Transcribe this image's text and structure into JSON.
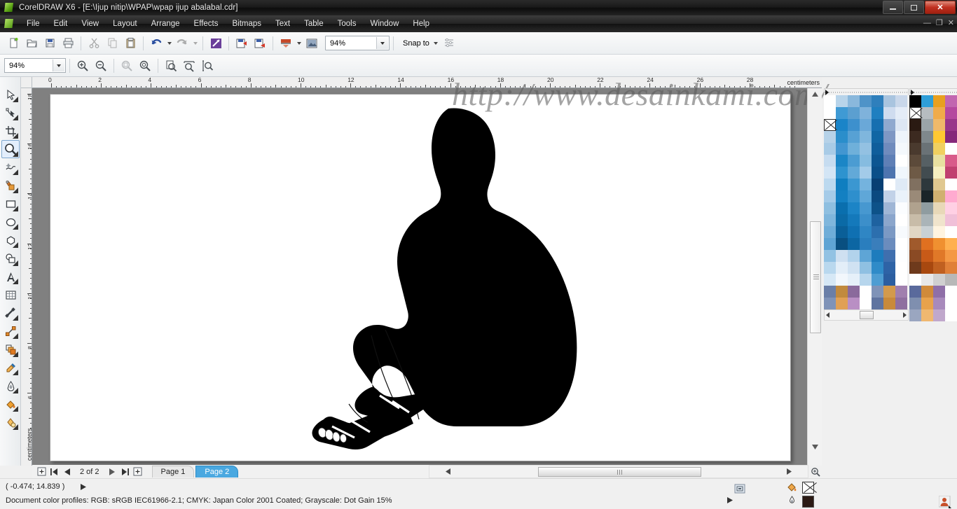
{
  "window": {
    "title": "CorelDRAW X6 - [E:\\Ijup nitip\\WPAP\\wpap ijup abalabal.cdr]",
    "app_name": "CorelDRAW X6",
    "minimize_label": "—",
    "restore_label": "❐",
    "close_label": "✕",
    "doc_minimize": "—",
    "doc_restore": "❐",
    "doc_close": "✕"
  },
  "menubar": {
    "items": [
      {
        "label": "File"
      },
      {
        "label": "Edit"
      },
      {
        "label": "View"
      },
      {
        "label": "Layout"
      },
      {
        "label": "Arrange"
      },
      {
        "label": "Effects"
      },
      {
        "label": "Bitmaps"
      },
      {
        "label": "Text"
      },
      {
        "label": "Table"
      },
      {
        "label": "Tools"
      },
      {
        "label": "Window"
      },
      {
        "label": "Help"
      }
    ]
  },
  "toolbar": {
    "zoom_value": "94%",
    "snap_label": "Snap to",
    "buttons": [
      {
        "name": "new-document",
        "tip": "New"
      },
      {
        "name": "open-document",
        "tip": "Open"
      },
      {
        "name": "save-document",
        "tip": "Save"
      },
      {
        "name": "print-document",
        "tip": "Print"
      },
      {
        "name": "cut",
        "tip": "Cut"
      },
      {
        "name": "copy",
        "tip": "Copy"
      },
      {
        "name": "paste",
        "tip": "Paste"
      },
      {
        "name": "undo",
        "tip": "Undo"
      },
      {
        "name": "redo",
        "tip": "Redo"
      },
      {
        "name": "import",
        "tip": "Import"
      },
      {
        "name": "export",
        "tip": "Export"
      },
      {
        "name": "publish-pdf",
        "tip": "Publish to PDF"
      },
      {
        "name": "application-launcher",
        "tip": "Application Launcher"
      },
      {
        "name": "corel-connect",
        "tip": "Corel CONNECT"
      },
      {
        "name": "options",
        "tip": "Options"
      }
    ]
  },
  "propertybar": {
    "zoom_value": "94%",
    "buttons": [
      {
        "name": "zoom-in"
      },
      {
        "name": "zoom-out"
      },
      {
        "name": "zoom-to-selected"
      },
      {
        "name": "zoom-to-all-objects"
      },
      {
        "name": "zoom-to-page"
      },
      {
        "name": "zoom-to-page-width"
      },
      {
        "name": "zoom-to-page-height"
      }
    ]
  },
  "toolbox": {
    "selected": "zoom-tool",
    "tools": [
      {
        "name": "pick-tool",
        "label": "Pick"
      },
      {
        "name": "shape-tool",
        "label": "Shape"
      },
      {
        "name": "crop-tool",
        "label": "Crop"
      },
      {
        "name": "zoom-tool",
        "label": "Zoom"
      },
      {
        "name": "freehand-tool",
        "label": "Freehand"
      },
      {
        "name": "smart-fill-tool",
        "label": "Smart Fill"
      },
      {
        "name": "rectangle-tool",
        "label": "Rectangle"
      },
      {
        "name": "ellipse-tool",
        "label": "Ellipse"
      },
      {
        "name": "polygon-tool",
        "label": "Polygon"
      },
      {
        "name": "basic-shapes-tool",
        "label": "Basic Shapes"
      },
      {
        "name": "text-tool",
        "label": "Text"
      },
      {
        "name": "table-tool",
        "label": "Table"
      },
      {
        "name": "dimension-tool",
        "label": "Parallel Dimension"
      },
      {
        "name": "connector-tool",
        "label": "Straight-Line Connector"
      },
      {
        "name": "blend-tool",
        "label": "Blend"
      },
      {
        "name": "color-eyedropper-tool",
        "label": "Color Eyedropper"
      },
      {
        "name": "outline-tool",
        "label": "Outline"
      },
      {
        "name": "fill-tool",
        "label": "Fill"
      },
      {
        "name": "interactive-fill-tool",
        "label": "Interactive Fill"
      }
    ]
  },
  "rulers": {
    "unit": "centimeters",
    "horizontal_labels": [
      "0",
      "2",
      "4",
      "6",
      "8",
      "10",
      "12",
      "14",
      "16",
      "18",
      "20",
      "22",
      "24",
      "26",
      "28"
    ],
    "vertical_labels": [
      "18",
      "16",
      "14",
      "12",
      "10",
      "8",
      "6"
    ]
  },
  "canvas": {
    "watermark": "http://www.desainkami.com/",
    "artwork_name": "sitting-person-silhouette"
  },
  "pagenav": {
    "count_label": "2 of 2",
    "tabs": [
      {
        "label": "Page 1",
        "active": false
      },
      {
        "label": "Page 2",
        "active": true
      }
    ],
    "add_page_left": "+",
    "first": "|◀",
    "prev": "◀",
    "next": "▶",
    "last": "▶|",
    "add_page_right": "+"
  },
  "statusbar": {
    "coordinates": "( -0.474; 14.839 )",
    "color_profiles": "Document color profiles: RGB: sRGB IEC61966-2.1; CMYK: Japan Color 2001 Coated; Grayscale: Dot Gain 15%",
    "fill_label": "Fill",
    "outline_label": "Outline",
    "fill_color": "none",
    "outline_color": "#2b1a14"
  },
  "palettes": {
    "custom": {
      "name": "custom-blue-palette",
      "columns": 7,
      "colors": [
        "#ffffff",
        "#b8d4ea",
        "#8ab8dc",
        "#4f93c8",
        "#2f7fbc",
        "#a9c4df",
        "#c9d7ea",
        "#ffffff",
        "#3f9ad4",
        "#5b9fd0",
        "#7fb2db",
        "#1f7fc0",
        "#cfdcef",
        "#e4ecf7",
        "#9cc3e2",
        "#1a84c8",
        "#3d90cd",
        "#6aa8d8",
        "#176fb0",
        "#8fa9cf",
        "#dde7f4",
        "#b6d2e8",
        "#2a8ecb",
        "#57a1d4",
        "#7fb6dd",
        "#1166a4",
        "#7e97c4",
        "#eef4fb",
        "#a8cbe6",
        "#4296d1",
        "#6fb0da",
        "#93c1e2",
        "#0f5e9c",
        "#6f8bbd",
        "#f4f8fc",
        "#c6dcf0",
        "#1b86c6",
        "#4b9cd2",
        "#86bce0",
        "#0c5692",
        "#5e7fb6",
        "#ffffff",
        "#d3e5f5",
        "#2d93cf",
        "#62a9d8",
        "#a3cbe9",
        "#0a4f89",
        "#4d74af",
        "#f0f6fc",
        "#bcd9ef",
        "#0f7ec0",
        "#3b97d1",
        "#74b3de",
        "#083f73",
        "#ffffff",
        "#dfeaf6",
        "#a5cbe8",
        "#1380c2",
        "#2e8fcd",
        "#5fa7d8",
        "#0b4a80",
        "#c2d2e8",
        "#eaf2fa",
        "#8ebfe0",
        "#0a6fae",
        "#1c84c6",
        "#4798d0",
        "#0d5289",
        "#9fb6d6",
        "#fbfdff",
        "#7fb6dc",
        "#0b6aa6",
        "#1479bb",
        "#3c8fca",
        "#1e62a0",
        "#8ba6cc",
        "#ffffff",
        "#6fadd8",
        "#0a5f98",
        "#0f70b2",
        "#2f86c4",
        "#2c6fae",
        "#7b99c4",
        "#f7fafd",
        "#5fa4d4",
        "#094f80",
        "#0c66a3",
        "#2a7ebe",
        "#3a7ebb",
        "#6b8cbd",
        "#ffffff",
        "#92c2e3",
        "#cfe0f1",
        "#b2d3ec",
        "#5ea5d6",
        "#1d7cbd",
        "#3f6fae",
        "#fdfeff",
        "#b9d8ee",
        "#e3eef8",
        "#d0e2f2",
        "#8fc0e2",
        "#2f8bc8",
        "#2e63a6",
        "#ffffff",
        "#d6e8f6",
        "#f2f7fc",
        "#e6f0f9",
        "#b7d6ed",
        "#4e9dd2",
        "#2b5ea0",
        "#ffffff",
        "#6a7fa8",
        "#c18a3e",
        "#8a6a9c",
        "#ffffff",
        "#7f93b8",
        "#d39a4c",
        "#a07fae",
        "#7f93b8",
        "#e0a055",
        "#b98fc4",
        "#ffffff",
        "#5f74a0",
        "#c98a3a",
        "#8f6fa0"
      ]
    },
    "default": {
      "name": "default-cmyk-palette",
      "columns": 5,
      "colors": [
        "#000000",
        "#2e9ed8",
        "#e8a020",
        "#c266b0",
        "#e8289c",
        "#ffffff",
        "#b6bcc0",
        "#f0ab4a",
        "#b5489f",
        "#d8247f",
        "#2a1a12",
        "#9aa4a8",
        "#efb96a",
        "#98368a",
        "#c01f68",
        "#3c2a20",
        "#7f888c",
        "#ffc832",
        "#86287a",
        "#a81a58",
        "#4a3a2e",
        "#6a7276",
        "#f0d060",
        "#ffffff",
        "#e8186a",
        "#5c4a3a",
        "#566064",
        "#e8e0a0",
        "#d85a8a",
        "#ff2a78",
        "#6e5a46",
        "#424c50",
        "#f5efc0",
        "#c04070",
        "#e01060",
        "#807060",
        "#2e383c",
        "#e0c890",
        "#ffffff",
        "#ff70a8",
        "#9a8a78",
        "#1a2428",
        "#d0b070",
        "#ffaad0",
        "#ff4a90",
        "#b0a28e",
        "#8f9ca0",
        "#e8d8b8",
        "#ffd0e4",
        "#ffffff",
        "#c8bca8",
        "#aab4b8",
        "#f0e4cc",
        "#f0c0d8",
        "#ffe0ec",
        "#e0d6c4",
        "#c8d0d4",
        "#fff4e0",
        "#ffffff",
        "#ffc0d8",
        "#a05a2c",
        "#e07020",
        "#f09030",
        "#ffb050",
        "#ffd080",
        "#8a4a24",
        "#c85a18",
        "#e07828",
        "#f49844",
        "#ffc070",
        "#6e3a1c",
        "#a8480f",
        "#c06020",
        "#e08038",
        "#f0a860",
        "#ffffff",
        "#e8e8e8",
        "#d0d0d0",
        "#b8b8b8",
        "#a0a0a0",
        "#5a6a9c",
        "#d08a3a",
        "#8f6fa8",
        "#ffffff",
        "#ffffff",
        "#7f8faf",
        "#e8a24c",
        "#a88abc",
        "#ffffff",
        "#ffffff",
        "#9aa6c0",
        "#f0b870",
        "#c0a8cc",
        "#ffffff",
        "#ffffff"
      ]
    }
  }
}
